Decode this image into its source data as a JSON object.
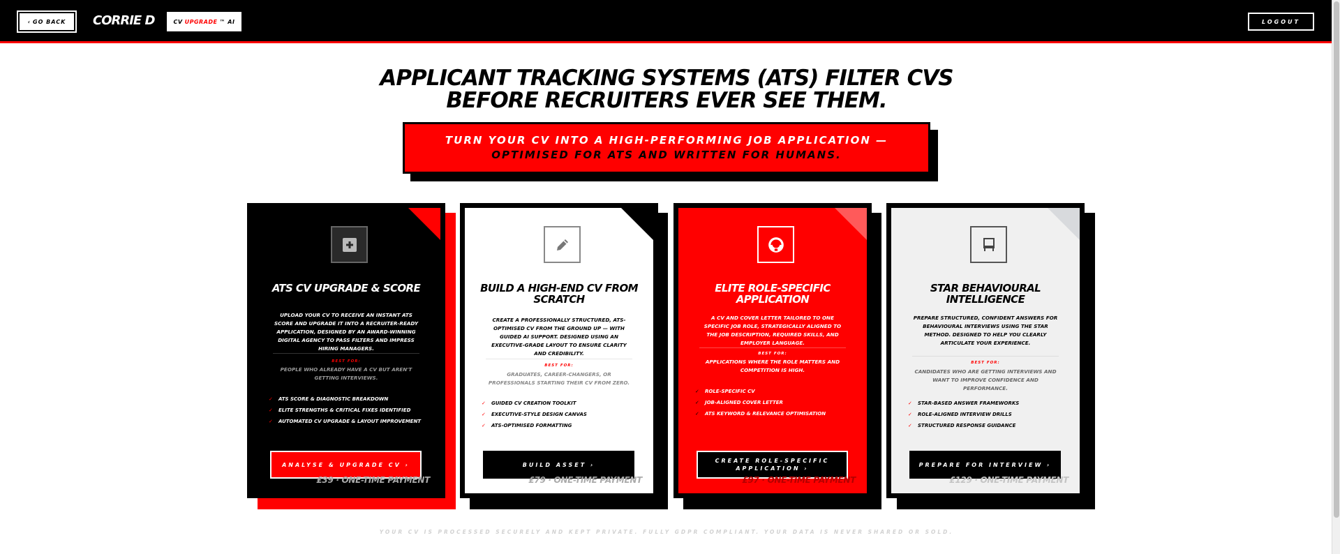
{
  "header": {
    "back_label": "GO BACK",
    "brand": "CORRIE D",
    "product_prefix": "CV",
    "product_highlight": "UPGRADE",
    "product_suffix": "™ AI",
    "logout_label": "LOGOUT"
  },
  "hero": {
    "headline_line1": "APPLICANT TRACKING SYSTEMS (ATS) FILTER CVS",
    "headline_line2": "BEFORE RECRUITERS EVER SEE THEM.",
    "banner_line1": "TURN YOUR CV INTO A HIGH-PERFORMING JOB APPLICATION —",
    "banner_line2": "OPTIMISED FOR ATS AND WRITTEN FOR HUMANS."
  },
  "cards": [
    {
      "icon": "plus-square-icon",
      "title": "ATS CV UPGRADE & SCORE",
      "description": "UPLOAD YOUR CV TO RECEIVE AN INSTANT ATS SCORE AND UPGRADE IT INTO A RECRUITER-READY APPLICATION, DESIGNED BY AN AWARD-WINNING DIGITAL AGENCY TO PASS FILTERS AND IMPRESS HIRING MANAGERS.",
      "best_for_label": "BEST FOR:",
      "best_for": "PEOPLE WHO ALREADY HAVE A CV BUT AREN'T GETTING INTERVIEWS.",
      "features": [
        "ATS SCORE & DIAGNOSTIC BREAKDOWN",
        "ELITE STRENGTHS & CRITICAL FIXES IDENTIFIED",
        "AUTOMATED CV UPGRADE & LAYOUT IMPROVEMENT"
      ],
      "cta": "ANALYSE & UPGRADE CV ›",
      "price": "£39 · ONE-TIME PAYMENT"
    },
    {
      "icon": "pencil-icon",
      "title": "BUILD A HIGH-END CV FROM SCRATCH",
      "description": "CREATE A PROFESSIONALLY STRUCTURED, ATS-OPTIMISED CV FROM THE GROUND UP — WITH GUIDED AI SUPPORT. DESIGNED USING AN EXECUTIVE-GRADE LAYOUT TO ENSURE CLARITY AND CREDIBILITY.",
      "best_for_label": "BEST FOR:",
      "best_for": "GRADUATES, CAREER-CHANGERS, OR PROFESSIONALS STARTING THEIR CV FROM ZERO.",
      "features": [
        "GUIDED CV CREATION TOOLKIT",
        "EXECUTIVE-STYLE DESIGN CANVAS",
        "ATS-OPTIMISED FORMATTING"
      ],
      "cta": "BUILD ASSET ›",
      "price": "£79 · ONE-TIME PAYMENT"
    },
    {
      "icon": "headset-icon",
      "title": "ELITE ROLE-SPECIFIC APPLICATION",
      "description": "A CV AND COVER LETTER TAILORED TO ONE SPECIFIC JOB ROLE, STRATEGICALLY ALIGNED TO THE JOB DESCRIPTION, REQUIRED SKILLS, AND EMPLOYER LANGUAGE.",
      "best_for_label": "BEST FOR:",
      "best_for": "APPLICATIONS WHERE THE ROLE MATTERS AND COMPETITION IS HIGH.",
      "features": [
        "ROLE-SPECIFIC CV",
        "JOB-ALIGNED COVER LETTER",
        "ATS KEYWORD & RELEVANCE OPTIMISATION"
      ],
      "cta": "CREATE ROLE-SPECIFIC APPLICATION ›",
      "price": "£97 · ONE-TIME PAYMENT"
    },
    {
      "icon": "chair-icon",
      "title": "STAR BEHAVIOURAL INTELLIGENCE",
      "description": "PREPARE STRUCTURED, CONFIDENT ANSWERS FOR BEHAVIOURAL INTERVIEWS USING THE STAR METHOD. DESIGNED TO HELP YOU CLEARLY ARTICULATE YOUR EXPERIENCE.",
      "best_for_label": "BEST FOR:",
      "best_for": "CANDIDATES WHO ARE GETTING INTERVIEWS AND WANT TO IMPROVE CONFIDENCE AND PERFORMANCE.",
      "features": [
        "STAR-BASED ANSWER FRAMEWORKS",
        "ROLE-ALIGNED INTERVIEW DRILLS",
        "STRUCTURED RESPONSE GUIDANCE"
      ],
      "cta": "PREPARE FOR INTERVIEW ›",
      "price": "£129 · ONE-TIME PAYMENT"
    }
  ],
  "footer": {
    "note": "YOUR CV IS PROCESSED SECURELY AND KEPT PRIVATE. FULLY GDPR COMPLIANT. YOUR DATA IS NEVER SHARED OR SOLD."
  },
  "colors": {
    "accent": "#ff0000",
    "ink": "#000000",
    "paper": "#ffffff",
    "muted": "#aaaaaa"
  }
}
